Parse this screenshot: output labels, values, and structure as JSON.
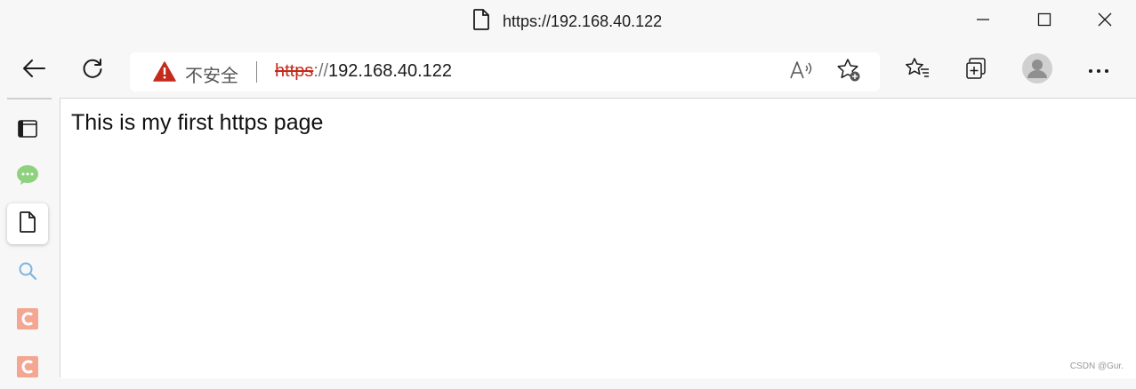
{
  "window": {
    "title": "https://192.168.40.122",
    "icons": [
      "document-icon",
      "minimize-icon",
      "maximize-icon",
      "close-icon"
    ]
  },
  "toolbar": {
    "icons": [
      "back-arrow-icon",
      "refresh-icon",
      "read-aloud-icon",
      "add-favorite-icon",
      "favorites-icon",
      "collections-icon",
      "profile-avatar-icon",
      "more-icon"
    ]
  },
  "address": {
    "security_label": "不安全",
    "url_scheme": "https",
    "url_slashes": "://",
    "url_host": "192.168.40.122",
    "warning_color": "#c42b1c"
  },
  "sidebar": {
    "items": [
      {
        "icon": "tab-actions-icon"
      },
      {
        "icon": "wechat-icon",
        "color": "#8fd17e"
      },
      {
        "icon": "page-icon",
        "active": true
      },
      {
        "icon": "search-icon",
        "color": "#7fb3e0"
      },
      {
        "icon": "csdn-icon",
        "color": "#f3a793"
      },
      {
        "icon": "csdn-icon",
        "color": "#f3a793"
      }
    ]
  },
  "page": {
    "text": "This is my first https page",
    "watermark": "CSDN @Gur."
  }
}
